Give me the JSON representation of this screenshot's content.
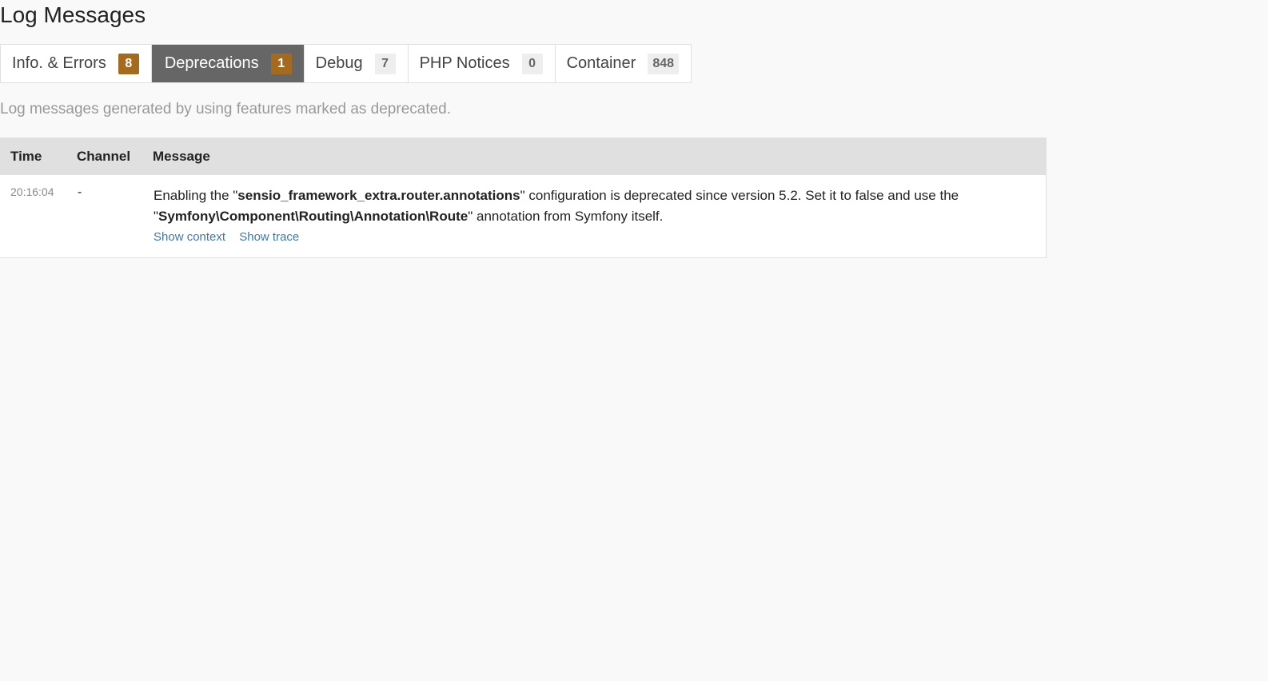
{
  "page": {
    "title": "Log Messages"
  },
  "tabs": [
    {
      "label": "Info. & Errors",
      "count": "8",
      "badge_status": "warning",
      "active": false
    },
    {
      "label": "Deprecations",
      "count": "1",
      "badge_status": "warning",
      "active": true
    },
    {
      "label": "Debug",
      "count": "7",
      "badge_status": "default",
      "active": false
    },
    {
      "label": "PHP Notices",
      "count": "0",
      "badge_status": "default",
      "active": false
    },
    {
      "label": "Container",
      "count": "848",
      "badge_status": "default",
      "active": false
    }
  ],
  "description": "Log messages generated by using features marked as deprecated.",
  "table": {
    "headers": {
      "time": "Time",
      "channel": "Channel",
      "message": "Message"
    },
    "rows": [
      {
        "time": "20:16:04",
        "channel": "-",
        "message": {
          "part1": "Enabling the \"",
          "bold1": "sensio_framework_extra.router.annotations",
          "part2": "\" configuration is deprecated since version 5.2. Set it to false and use the \"",
          "bold2": "Symfony\\Component\\Routing\\Annotation\\Route",
          "part3": "\" annotation from Symfony itself."
        },
        "links": {
          "context": "Show context",
          "trace": "Show trace"
        }
      }
    ]
  },
  "colors": {
    "active_tab_bg": "#666666",
    "warning_badge": "#a46a1f",
    "link": "#4078a6",
    "header_bg": "#e0e0e0"
  }
}
